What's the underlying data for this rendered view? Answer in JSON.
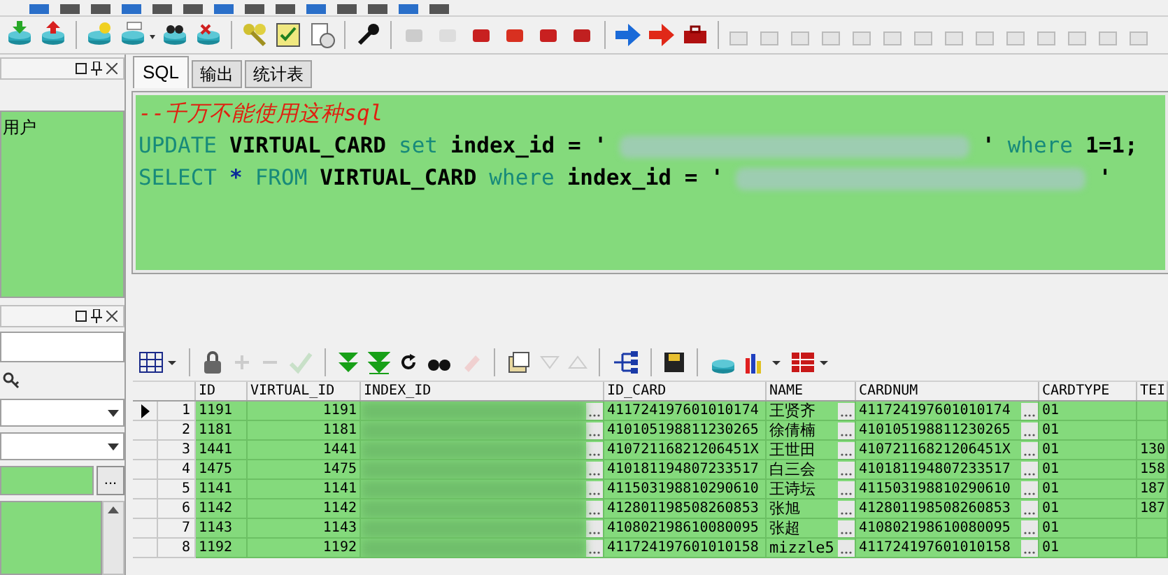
{
  "object_panel": {
    "items": [
      "用户"
    ]
  },
  "filter_panel": {
    "browse_button": "..."
  },
  "editor": {
    "tabs": [
      {
        "label": "SQL",
        "selected": true
      },
      {
        "label": "输出",
        "selected": false
      },
      {
        "label": "统计表",
        "selected": false
      }
    ],
    "lines": [
      [
        {
          "text": "--千万不能使用这种sql",
          "kind": "comment"
        }
      ],
      [
        {
          "text": "UPDATE",
          "kind": "keyword"
        },
        {
          "text": "VIRTUAL_CARD",
          "kind": "ident"
        },
        {
          "text": "set",
          "kind": "keyword"
        },
        {
          "text": "index_id = '",
          "kind": "ident"
        },
        {
          "kind": "redacted"
        },
        {
          "text": "'",
          "kind": "ident"
        },
        {
          "text": "where",
          "kind": "keyword"
        },
        {
          "text": "1=1;",
          "kind": "ident"
        }
      ],
      [
        {
          "text": "SELECT",
          "kind": "keyword"
        },
        {
          "text": "*",
          "kind": "operator"
        },
        {
          "text": "FROM",
          "kind": "keyword"
        },
        {
          "text": "VIRTUAL_CARD",
          "kind": "ident"
        },
        {
          "text": "where",
          "kind": "keyword"
        },
        {
          "text": "index_id = '",
          "kind": "ident"
        },
        {
          "kind": "redacted"
        },
        {
          "text": "'",
          "kind": "ident"
        }
      ]
    ]
  },
  "grid": {
    "columns": [
      "ID",
      "VIRTUAL_ID",
      "INDEX_ID",
      "ID_CARD",
      "NAME",
      "CARDNUM",
      "CARDTYPE",
      "TEI"
    ],
    "rows": [
      {
        "selected": true,
        "number": "1",
        "cells": [
          "1191",
          "1191",
          "",
          "411724197601010174",
          "王贤齐",
          "411724197601010174",
          "01",
          ""
        ]
      },
      {
        "selected": false,
        "number": "2",
        "cells": [
          "1181",
          "1181",
          "",
          "410105198811230265",
          "徐倩楠",
          "410105198811230265",
          "01",
          ""
        ]
      },
      {
        "selected": false,
        "number": "3",
        "cells": [
          "1441",
          "1441",
          "",
          "41072116821206451X",
          "王世田",
          "41072116821206451X",
          "01",
          "130"
        ]
      },
      {
        "selected": false,
        "number": "4",
        "cells": [
          "1475",
          "1475",
          "",
          "410181194807233517",
          "白三会",
          "410181194807233517",
          "01",
          "158"
        ]
      },
      {
        "selected": false,
        "number": "5",
        "cells": [
          "1141",
          "1141",
          "",
          "411503198810290610",
          "王诗坛",
          "411503198810290610",
          "01",
          "187"
        ]
      },
      {
        "selected": false,
        "number": "6",
        "cells": [
          "1142",
          "1142",
          "",
          "412801198508260853",
          "张旭",
          "412801198508260853",
          "01",
          "187"
        ]
      },
      {
        "selected": false,
        "number": "7",
        "cells": [
          "1143",
          "1143",
          "",
          "410802198610080095",
          "张超",
          "410802198610080095",
          "01",
          ""
        ]
      },
      {
        "selected": false,
        "number": "8",
        "cells": [
          "1192",
          "1192",
          "",
          "411724197601010158",
          "mizzle5",
          "411724197601010158",
          "01",
          ""
        ]
      }
    ]
  }
}
